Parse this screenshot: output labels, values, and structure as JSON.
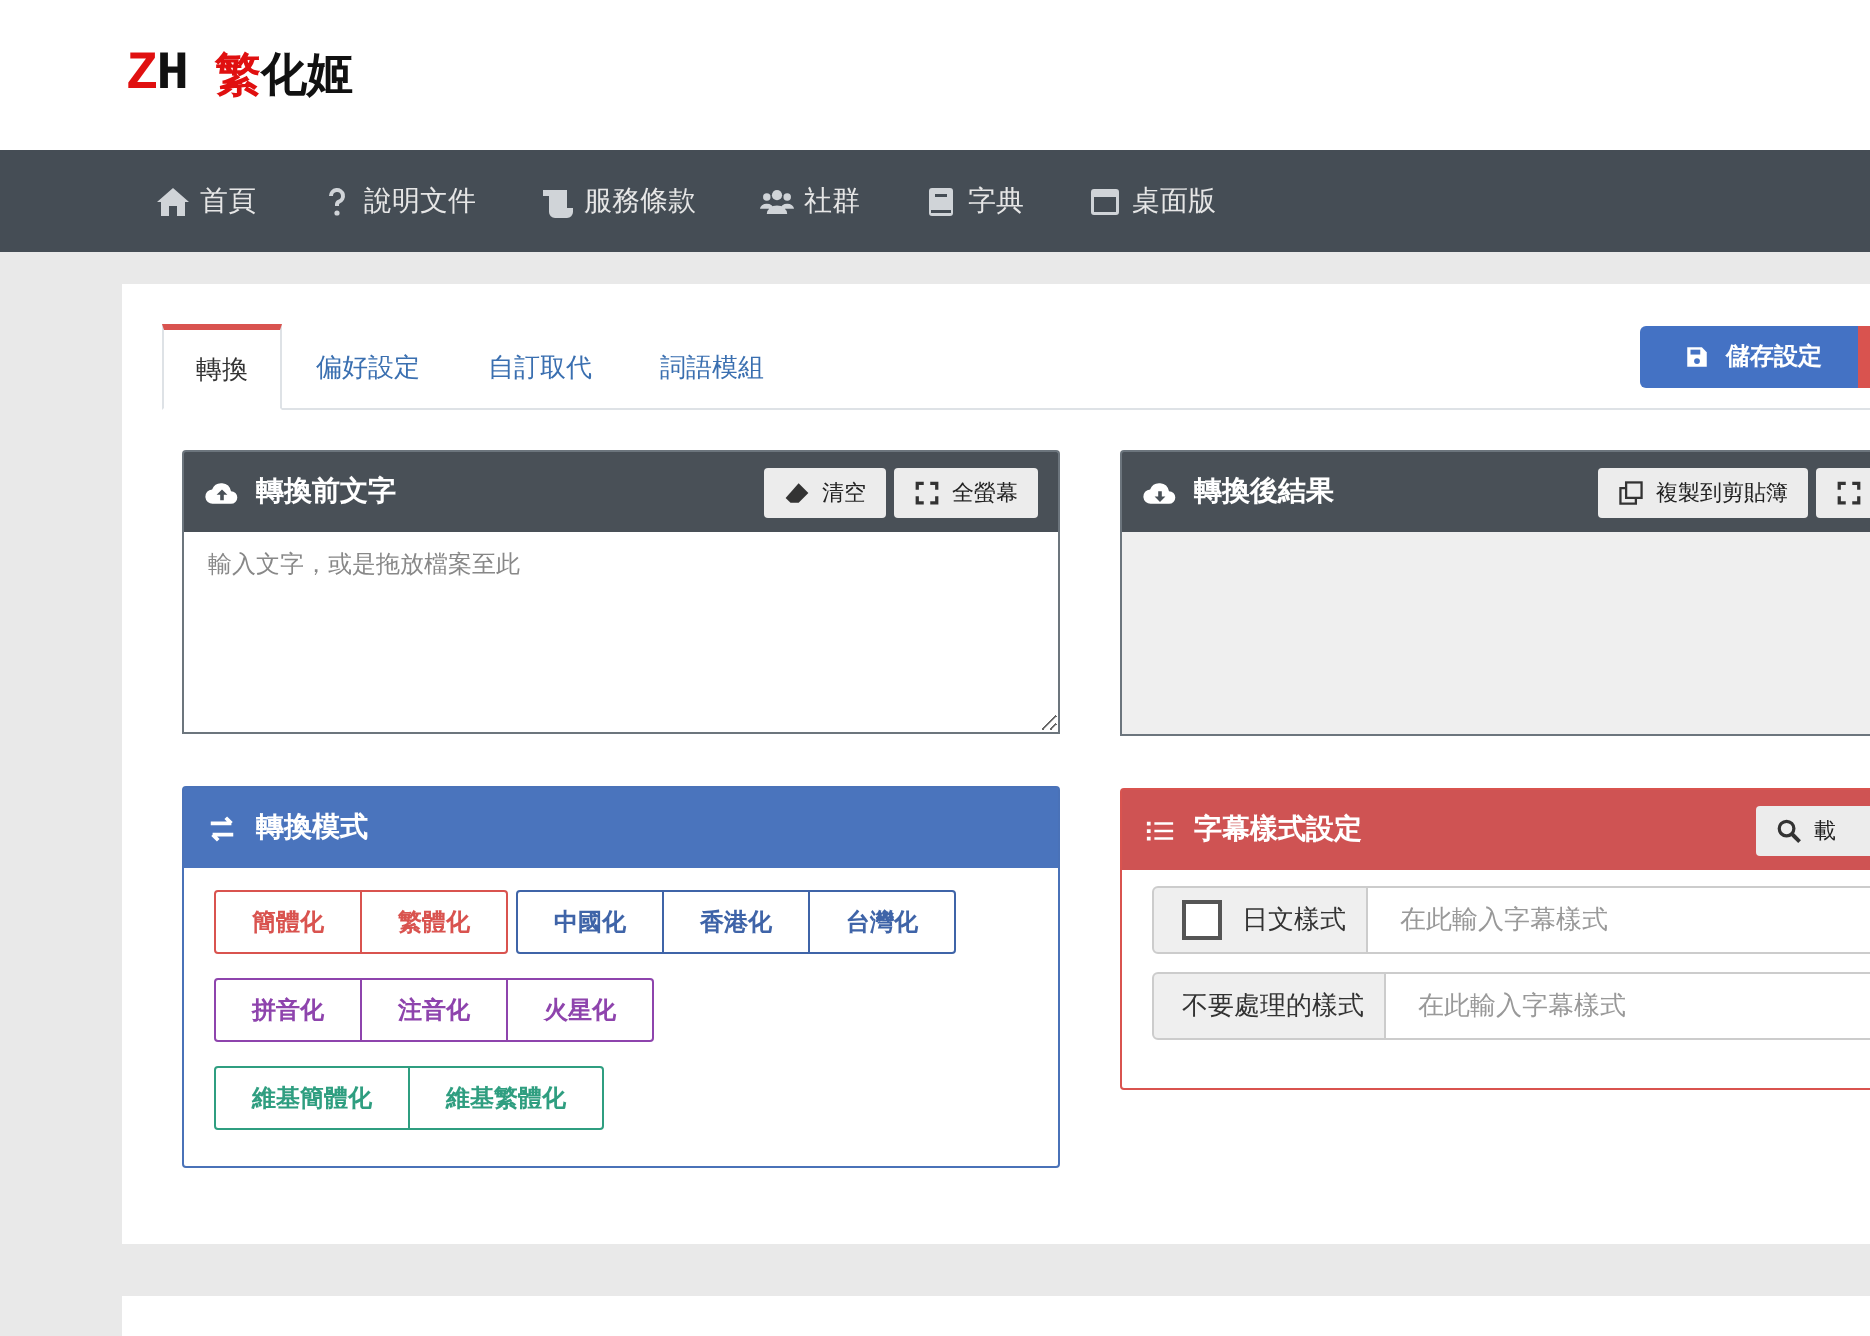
{
  "logo": {
    "mark": "ZH",
    "brand_accent": "繁",
    "brand_rest": "化姬"
  },
  "nav": [
    {
      "label": "首頁"
    },
    {
      "label": "說明文件"
    },
    {
      "label": "服務條款"
    },
    {
      "label": "社群"
    },
    {
      "label": "字典"
    },
    {
      "label": "桌面版"
    }
  ],
  "tabs": [
    {
      "label": "轉換",
      "selected": true
    },
    {
      "label": "偏好設定",
      "selected": false
    },
    {
      "label": "自訂取代",
      "selected": false
    },
    {
      "label": "詞語模組",
      "selected": false
    }
  ],
  "toolbar": {
    "save_button": "儲存設定"
  },
  "source_panel": {
    "title": "轉換前文字",
    "buttons": [
      {
        "kind": "clear",
        "label": "清空"
      },
      {
        "kind": "fullscreen",
        "label": "全螢幕"
      }
    ],
    "placeholder": "輸入文字，或是拖放檔案至此"
  },
  "result_panel": {
    "title": "轉換後結果",
    "buttons": [
      {
        "kind": "copy",
        "label": "複製到剪貼簿"
      },
      {
        "kind": "fullscreen"
      }
    ]
  },
  "mode_panel": {
    "title": "轉換模式",
    "groups": [
      {
        "color": "#d9534f",
        "buttons": [
          "簡體化",
          "繁體化"
        ]
      },
      {
        "color": "#3f64a8",
        "buttons": [
          "中國化",
          "香港化",
          "台灣化"
        ]
      },
      {
        "color": "#8e44ad",
        "buttons": [
          "拼音化",
          "注音化",
          "火星化"
        ]
      },
      {
        "color": "#2f9e80",
        "buttons": [
          "維基簡體化",
          "維基繁體化"
        ]
      }
    ]
  },
  "subtitle_panel": {
    "title": "字幕樣式設定",
    "load_button": "載",
    "rows": [
      {
        "kind": "checkbox",
        "label": "日文樣式",
        "checked": false,
        "placeholder": "在此輸入字幕樣式"
      },
      {
        "kind": "plain",
        "label": "不要處理的樣式",
        "placeholder": "在此輸入字幕樣式"
      }
    ]
  }
}
